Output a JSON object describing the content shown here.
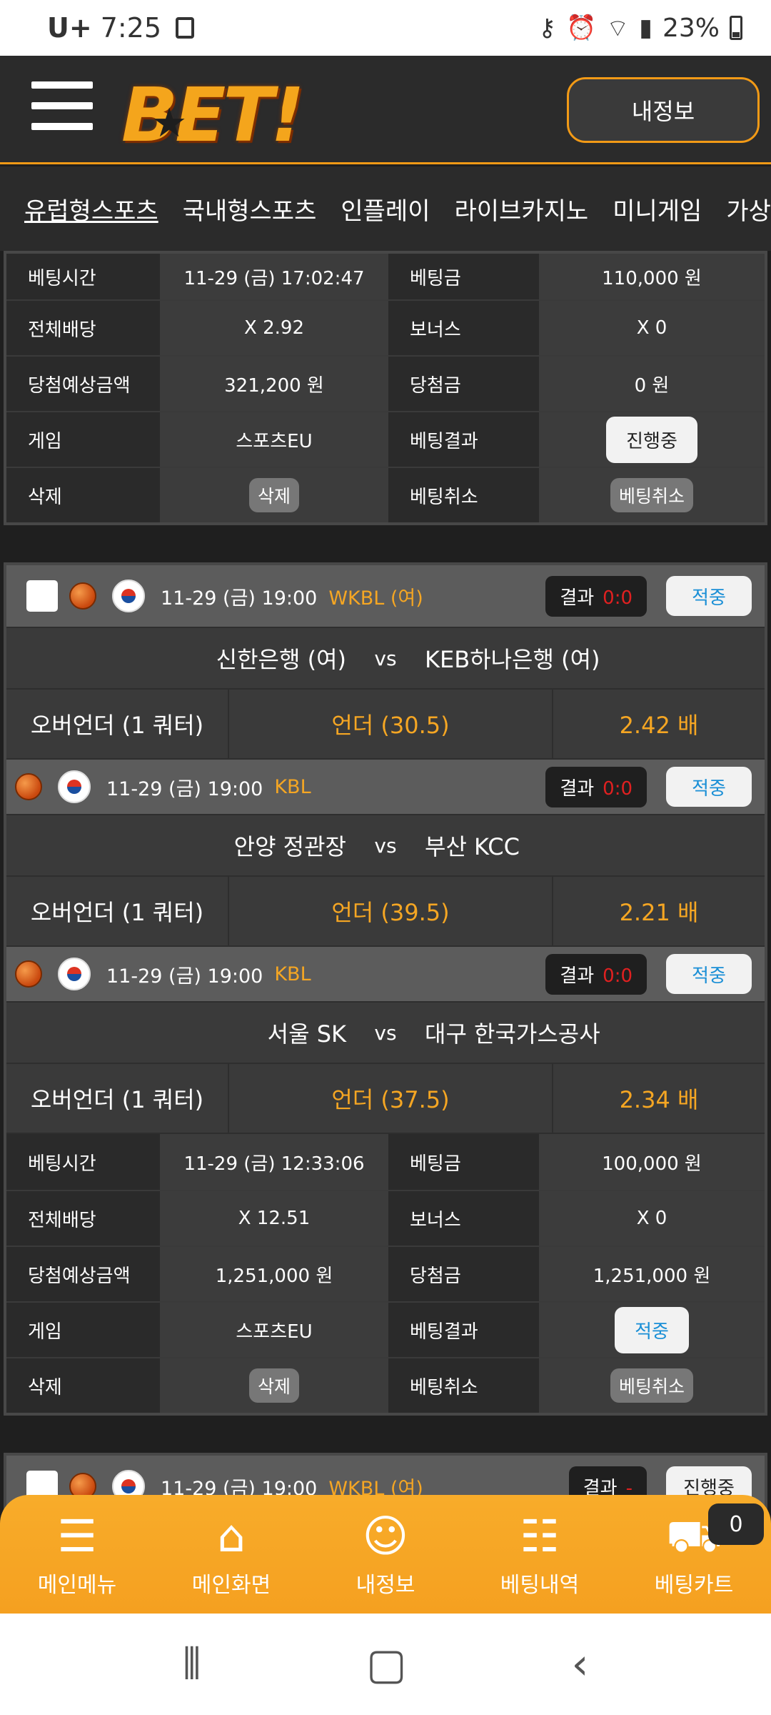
{
  "status": {
    "carrier": "U+",
    "time": "7:25",
    "battery": "23%"
  },
  "header": {
    "logo": "BET!",
    "myinfo_label": "내정보"
  },
  "nav": [
    "유럽형스포츠",
    "국내형스포츠",
    "인플레이",
    "라이브카지노",
    "미니게임",
    "가상게임"
  ],
  "labels": {
    "bet_time": "베팅시간",
    "total_odds": "전체배당",
    "expected_win": "당첨예상금액",
    "game": "게임",
    "delete": "삭제",
    "bet_amount": "베팅금",
    "bonus": "보너스",
    "win_amount": "당첨금",
    "bet_result": "베팅결과",
    "bet_cancel": "베팅취소",
    "delete_btn": "삭제",
    "cancel_btn": "베팅취소",
    "vs": "vs",
    "result": "결과"
  },
  "slip1": {
    "bet_time": "11-29 (금) 17:02:47",
    "bet_amount": "110,000 원",
    "total_odds": "X 2.92",
    "bonus": "X 0",
    "expected_win": "321,200 원",
    "win_amount": "0 원",
    "game": "스포츠EU",
    "status": "진행중"
  },
  "matches": [
    {
      "date": "11-29 (금) 19:00",
      "league": "WKBL (여)",
      "score": "0:0",
      "status": "적중",
      "home": "신한은행 (여)",
      "away": "KEB하나은행 (여)",
      "pick_type": "오버언더 (1 쿼터)",
      "pick": "언더  (30.5)",
      "odds": "2.42 배"
    },
    {
      "date": "11-29 (금) 19:00",
      "league": "KBL",
      "score": "0:0",
      "status": "적중",
      "home": "안양 정관장",
      "away": "부산 KCC",
      "pick_type": "오버언더 (1 쿼터)",
      "pick": "언더  (39.5)",
      "odds": "2.21 배"
    },
    {
      "date": "11-29 (금) 19:00",
      "league": "KBL",
      "score": "0:0",
      "status": "적중",
      "home": "서울 SK",
      "away": "대구 한국가스공사",
      "pick_type": "오버언더 (1 쿼터)",
      "pick": "언더  (37.5)",
      "odds": "2.34 배"
    }
  ],
  "slip2": {
    "bet_time": "11-29 (금) 12:33:06",
    "bet_amount": "100,000 원",
    "total_odds": "X 12.51",
    "bonus": "X 0",
    "expected_win": "1,251,000 원",
    "win_amount": "1,251,000 원",
    "game": "스포츠EU",
    "status": "적중"
  },
  "next_match": {
    "date": "11-29 (금) 19:00",
    "league": "WKBL (여)",
    "score": "-",
    "status": "진행중"
  },
  "bottom_nav": {
    "menu": "메인메뉴",
    "home": "메인화면",
    "my": "내정보",
    "history": "베팅내역",
    "cart": "베팅카트",
    "cart_count": "0"
  },
  "colors": {
    "accent": "#f29a16",
    "odds": "#f5a623",
    "score": "#e02020",
    "hit": "#1a8fd6"
  }
}
